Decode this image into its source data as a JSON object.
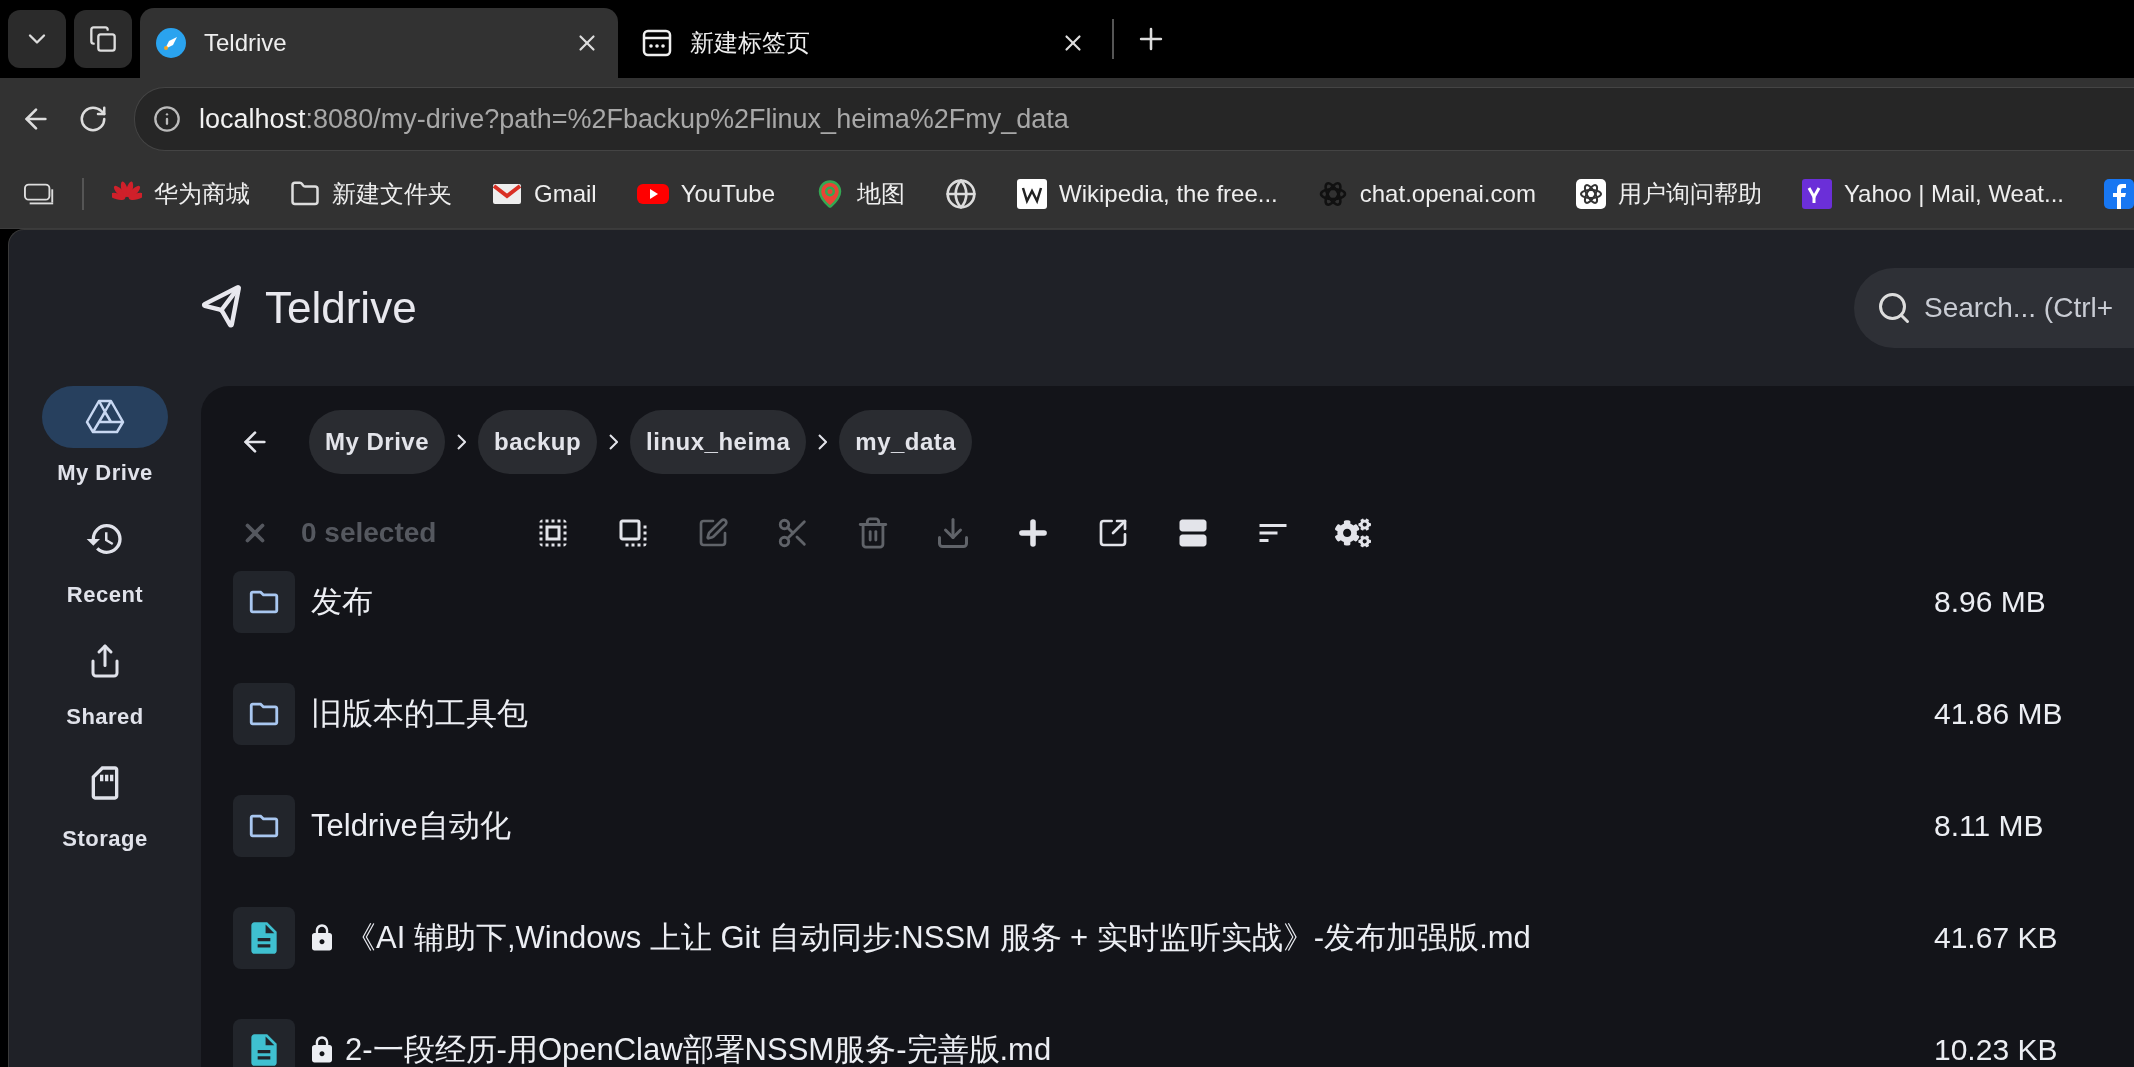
{
  "browser": {
    "tabs": [
      {
        "title": "Teldrive",
        "selected": true,
        "kind": "app"
      },
      {
        "title": "新建标签页",
        "selected": false,
        "kind": "newtab"
      }
    ],
    "address": {
      "host": "localhost",
      "rest": ":8080/my-drive?path=%2Fbackup%2Flinux_heima%2Fmy_data"
    },
    "bookmarks": [
      {
        "label": "华为商城",
        "kind": "huawei"
      },
      {
        "label": "新建文件夹",
        "kind": "folder"
      },
      {
        "label": "Gmail",
        "kind": "gmail"
      },
      {
        "label": "YouTube",
        "kind": "youtube"
      },
      {
        "label": "地图",
        "kind": "maps"
      },
      {
        "kind": "globe"
      },
      {
        "label": "Wikipedia, the free...",
        "kind": "wiki"
      },
      {
        "label": "chat.openai.com",
        "kind": "openai"
      },
      {
        "label": "用户询问帮助",
        "kind": "openai-light"
      },
      {
        "label": "Yahoo | Mail, Weat...",
        "kind": "yahoo"
      },
      {
        "kind": "facebook"
      }
    ]
  },
  "app": {
    "title": "Teldrive",
    "search": {
      "placeholder": "Search... (Ctrl+"
    }
  },
  "sidebar": {
    "items": [
      {
        "label": "My Drive",
        "kind": "drive",
        "selected": true
      },
      {
        "label": "Recent",
        "kind": "recent",
        "selected": false
      },
      {
        "label": "Shared",
        "kind": "shared",
        "selected": false
      },
      {
        "label": "Storage",
        "kind": "storage",
        "selected": false
      }
    ]
  },
  "breadcrumbs": [
    "My Drive",
    "backup",
    "linux_heima",
    "my_data"
  ],
  "toolbar": {
    "selection": "0 selected",
    "actions": [
      {
        "kind": "select-all",
        "disabled": false
      },
      {
        "kind": "copy",
        "disabled": false
      },
      {
        "kind": "edit",
        "disabled": true
      },
      {
        "kind": "cut",
        "disabled": true
      },
      {
        "kind": "delete",
        "disabled": true
      },
      {
        "kind": "download",
        "disabled": true
      },
      {
        "kind": "add",
        "disabled": false
      },
      {
        "kind": "open",
        "disabled": false
      },
      {
        "kind": "layout",
        "disabled": false
      },
      {
        "kind": "sort",
        "disabled": false
      },
      {
        "kind": "settings",
        "disabled": false
      }
    ]
  },
  "files": [
    {
      "name": "发布",
      "kind": "folder",
      "locked": false,
      "size": "8.96 MB"
    },
    {
      "name": "旧版本的工具包",
      "kind": "folder",
      "locked": false,
      "size": "41.86 MB"
    },
    {
      "name": "Teldrive自动化",
      "kind": "folder",
      "locked": false,
      "size": "8.11 MB"
    },
    {
      "name": "《AI 辅助下,Windows 上让 Git 自动同步:NSSM 服务 + 实时监听实战》-发布加强版.md",
      "kind": "file",
      "locked": true,
      "size": "41.67 KB"
    },
    {
      "name": "2-一段经历-用OpenClaw部署NSSM服务-完善版.md",
      "kind": "file",
      "locked": true,
      "size": "10.23 KB"
    }
  ]
}
